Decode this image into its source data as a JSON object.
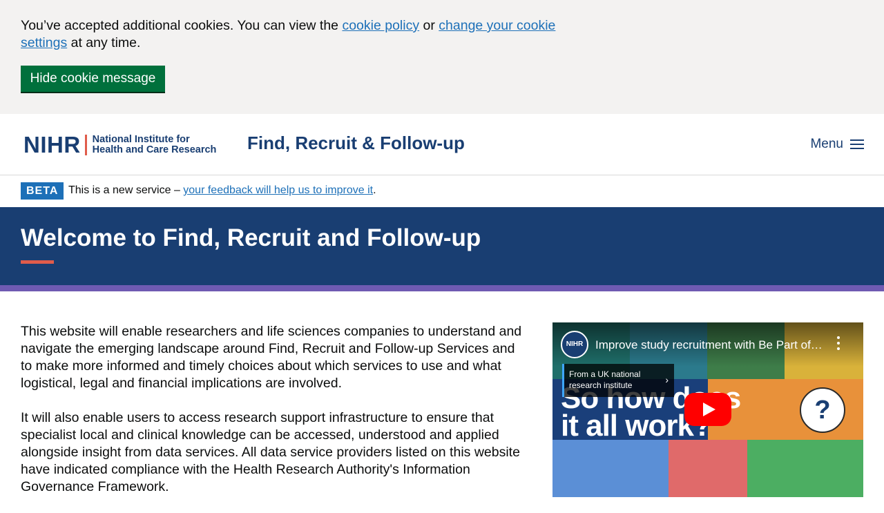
{
  "cookie_banner": {
    "text_before": "You’ve accepted additional cookies. You can view the ",
    "cookie_policy_link": "cookie policy",
    "text_or": " or ",
    "change_settings_link": "change your cookie settings",
    "text_after": " at any time.",
    "hide_button": "Hide cookie message"
  },
  "header": {
    "logo_mark": "NIHR",
    "logo_line1": "National Institute for",
    "logo_line2": "Health and Care Research",
    "service_name": "Find, Recruit & Follow-up",
    "menu_label": "Menu"
  },
  "beta": {
    "tag": "BETA",
    "text_before": "This is a new service – ",
    "feedback_link": "your feedback will help us to improve it",
    "text_after": "."
  },
  "hero": {
    "title": "Welcome to Find, Recruit and Follow-up"
  },
  "content": {
    "paragraph1": "This website will enable researchers and life sciences companies to understand and navigate the emerging landscape around Find, Recruit and Follow-up Services and to make more informed and timely choices about which services to use and what logistical, legal and financial implications are involved.",
    "paragraph2": "It will also enable users to access research support infrastructure to ensure that specialist local and clinical knowledge can be accessed, understood and applied alongside insight from data services. All data service providers listed on this website have indicated compliance with the Health Research Authority's Information Governance Framework."
  },
  "video": {
    "channel_logo": "NIHR",
    "title": "Improve study recruitment with Be Part of Research",
    "info_card": "From a UK national research institute",
    "overlay_line1": "So how does",
    "overlay_line2": "it all work?",
    "question_mark": "?",
    "icons": [
      "more-icon",
      "play-icon",
      "chevron-right-icon"
    ]
  },
  "colors": {
    "nihr_blue": "#193e72",
    "link_blue": "#1d70b8",
    "button_green": "#00703c",
    "accent_coral": "#e05c4b",
    "stripe_purple": "#6f5ab2",
    "youtube_red": "#ff0000"
  }
}
